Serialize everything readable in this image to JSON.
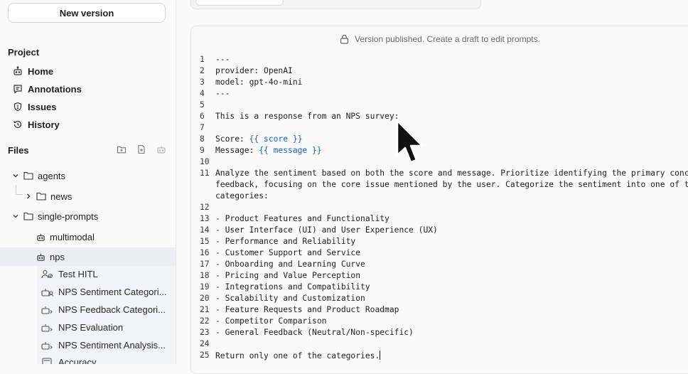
{
  "sidebar": {
    "new_version": "New version",
    "project_title": "Project",
    "nav": [
      {
        "label": "Home",
        "icon": "robot-icon"
      },
      {
        "label": "Annotations",
        "icon": "comment-icon"
      },
      {
        "label": "Issues",
        "icon": "shield-alert-icon"
      },
      {
        "label": "History",
        "icon": "history-icon"
      }
    ],
    "files_title": "Files",
    "tree": {
      "agents": "agents",
      "news": "news",
      "single_prompts": "single-prompts",
      "multimodal": "multimodal",
      "nps": "nps",
      "children": [
        "Test HITL",
        "NPS Sentiment Categori...",
        "NPS Feedback Categori...",
        "NPS Evaluation",
        "NPS Sentiment Analysis...",
        "Accuracy"
      ]
    }
  },
  "editor": {
    "banner": "Version published. Create a draft to edit prompts.",
    "lines": [
      {
        "n": "1",
        "t": "---"
      },
      {
        "n": "2",
        "t": "provider: OpenAI"
      },
      {
        "n": "3",
        "t": "model: gpt-4o-mini"
      },
      {
        "n": "4",
        "t": "---"
      },
      {
        "n": "5",
        "t": ""
      },
      {
        "n": "6",
        "t": "This is a response from an NPS survey:"
      },
      {
        "n": "7",
        "t": ""
      },
      {
        "n": "8",
        "t": "Score: ",
        "v": "{{ score }}"
      },
      {
        "n": "9",
        "t": "Message: ",
        "v": "{{ message }}"
      },
      {
        "n": "10",
        "t": ""
      },
      {
        "n": "11",
        "t": "Analyze the sentiment based on both the score and message. Prioritize identifying the primary concern in"
      },
      {
        "n": "",
        "t": "feedback, focusing on the core issue mentioned by the user. Categorize the sentiment into one of the fol"
      },
      {
        "n": "",
        "t": "categories:"
      },
      {
        "n": "12",
        "t": ""
      },
      {
        "n": "13",
        "t": "- Product Features and Functionality"
      },
      {
        "n": "14",
        "t": "- User Interface (UI) and User Experience (UX)"
      },
      {
        "n": "15",
        "t": "- Performance and Reliability"
      },
      {
        "n": "16",
        "t": "- Customer Support and Service"
      },
      {
        "n": "17",
        "t": "- Onboarding and Learning Curve"
      },
      {
        "n": "18",
        "t": "- Pricing and Value Perception"
      },
      {
        "n": "19",
        "t": "- Integrations and Compatibility"
      },
      {
        "n": "20",
        "t": "- Scalability and Customization"
      },
      {
        "n": "21",
        "t": "- Feature Requests and Product Roadmap"
      },
      {
        "n": "22",
        "t": "- Competitor Comparison"
      },
      {
        "n": "23",
        "t": "- General Feedback (Neutral/Non-specific)"
      },
      {
        "n": "24",
        "t": ""
      },
      {
        "n": "25",
        "t": "Return only one of the categories."
      }
    ]
  },
  "colors": {
    "accent": "#1d5fd1",
    "selected_bg": "#eceef3"
  }
}
